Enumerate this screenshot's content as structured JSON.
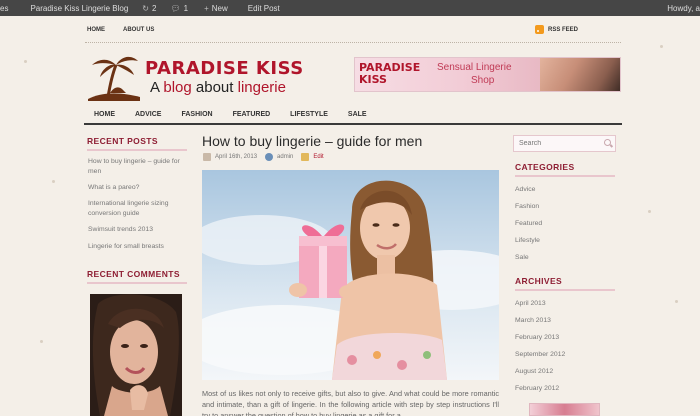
{
  "admin_bar": {
    "items": [
      {
        "label": "es",
        "icon": ""
      },
      {
        "label": "Paradise Kiss Lingerie Blog",
        "icon": ""
      },
      {
        "label": "2",
        "icon": "refresh-icon"
      },
      {
        "label": "1",
        "icon": "comment-bubble-icon"
      },
      {
        "label": "New",
        "icon": "plus-icon"
      },
      {
        "label": "Edit Post",
        "icon": ""
      }
    ],
    "howdy": "Howdy, a"
  },
  "top_nav": {
    "items": [
      "HOME",
      "ABOUT US"
    ],
    "rss_label": "RSS FEED"
  },
  "logo": {
    "title": "PARADISE KISS",
    "tagline_a": "A",
    "tagline_b": "blog",
    "tagline_c": "about",
    "tagline_d": "lingerie"
  },
  "banner": {
    "brand_line1": "PARADISE",
    "brand_line2": "KISS",
    "text_a": "Sensual",
    "text_b": "Lingerie",
    "text_c": "Shop"
  },
  "main_nav": {
    "items": [
      "HOME",
      "ADVICE",
      "FASHION",
      "FEATURED",
      "LIFESTYLE",
      "SALE"
    ]
  },
  "left_sidebar": {
    "recent_posts_title": "RECENT POSTS",
    "recent_posts": [
      "How to buy lingerie – guide for men",
      "What is a pareo?",
      "International lingerie sizing conversion guide",
      "Swimsuit trends 2013",
      "Lingerie for small breasts"
    ],
    "recent_comments_title": "RECENT COMMENTS"
  },
  "post": {
    "title": "How to buy lingerie – guide for men",
    "date": "April 16th, 2013",
    "author": "admin",
    "edit_label": "Edit",
    "excerpt": "Most of us likes not only to receive gifts, but also to give. And what could be more romantic and intimate, than a gift of lingerie. In the following article with step by step instructions I'll try to answer the question of how to buy lingerie as a gift for a"
  },
  "right_sidebar": {
    "search_placeholder": "Search",
    "categories_title": "CATEGORIES",
    "categories": [
      "Advice",
      "Fashion",
      "Featured",
      "Lifestyle",
      "Sale"
    ],
    "archives_title": "ARCHIVES",
    "archives": [
      "April 2013",
      "March 2013",
      "February 2013",
      "September 2012",
      "August 2012",
      "February 2012"
    ]
  },
  "colors": {
    "brand_red": "#b0152b",
    "sidebar_heading": "#8e1e33",
    "admin_bar_bg": "#464646",
    "page_bg": "#f4efe8"
  }
}
